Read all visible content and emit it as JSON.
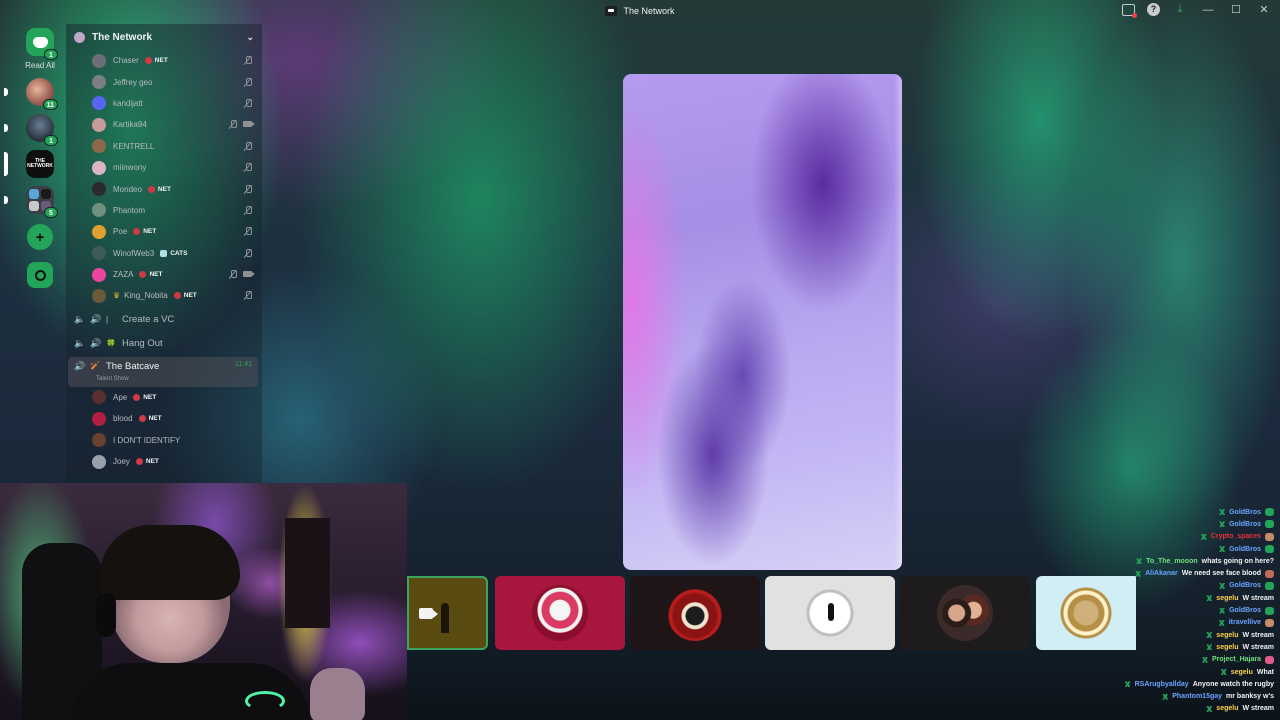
{
  "window": {
    "title": "The Network"
  },
  "rail": {
    "dm_badge": "1",
    "read_all": "Read All",
    "servers": [
      {
        "name": "server-1",
        "badge": "11"
      },
      {
        "name": "server-2",
        "badge": "1"
      },
      {
        "name": "the-network",
        "label": "THE NETWORK"
      },
      {
        "name": "folder",
        "badge": "5"
      }
    ],
    "add_label": "+"
  },
  "server": {
    "name": "The Network"
  },
  "voice_users_top": [
    {
      "name": "Chaser",
      "tag": "NET",
      "avatar": "#6d6f78",
      "icons": [
        "mic-off"
      ]
    },
    {
      "name": "Jeffrey geo",
      "tag": "",
      "avatar": "#7a7f86",
      "icons": [
        "mic-off"
      ]
    },
    {
      "name": "kandijatt",
      "tag": "",
      "avatar": "#5865f2",
      "icons": [
        "mic-off"
      ]
    },
    {
      "name": "Kartika94",
      "tag": "",
      "avatar": "#c89a9a",
      "icons": [
        "mic-off",
        "camera"
      ]
    },
    {
      "name": "KENTRELL",
      "tag": "",
      "avatar": "#8a6a4a",
      "icons": [
        "mic-off"
      ]
    },
    {
      "name": "miinwony",
      "tag": "",
      "avatar": "#d8b4c4",
      "icons": [
        "mic-off"
      ]
    },
    {
      "name": "Mondeo",
      "tag": "NET",
      "avatar": "#2a2a2f",
      "icons": [
        "mic-off"
      ]
    },
    {
      "name": "Phantom",
      "tag": "",
      "avatar": "#6f8f7f",
      "icons": [
        "mic-off"
      ]
    },
    {
      "name": "Poe",
      "tag": "NET",
      "avatar": "#e0a030",
      "icons": [
        "mic-off"
      ]
    },
    {
      "name": "WinofWeb3",
      "tag": "CATS",
      "avatar": "#3f5a5a",
      "icons": [
        "mic-off"
      ]
    },
    {
      "name": "ZAZA",
      "tag": "NET",
      "avatar": "#eb459e",
      "icons": [
        "mic-off",
        "camera"
      ]
    },
    {
      "name": "King_Nobita",
      "tag": "NET",
      "avatar": "#6a5a3a",
      "icons": [
        "mic-off"
      ]
    }
  ],
  "voice_channels": [
    {
      "name": "Create a VC",
      "emoji": "|"
    },
    {
      "name": "Hang Out",
      "emoji": "🍀"
    }
  ],
  "active_channel": {
    "name": "The Batcave",
    "time": "11:41",
    "status": "Talent Show"
  },
  "voice_users_bottom": [
    {
      "name": "Ape",
      "tag": "NET",
      "avatar": "#5a3030"
    },
    {
      "name": "blood",
      "tag": "NET",
      "avatar": "#b02040"
    },
    {
      "name": "I DON'T IDENTIFY",
      "tag": "",
      "avatar": "#6a4030"
    },
    {
      "name": "Joey",
      "tag": "NET",
      "avatar": "#9aa0aa"
    }
  ],
  "chat": [
    {
      "user": "GoldBros",
      "color": "#6aa4ff",
      "msg": "",
      "emote": "#23a559"
    },
    {
      "user": "GoldBros",
      "color": "#6aa4ff",
      "msg": "",
      "emote": "#23a559"
    },
    {
      "user": "Crypto_spaces",
      "color": "#e8333a",
      "msg": "",
      "emote": "#c78a6a"
    },
    {
      "user": "GoldBros",
      "color": "#6aa4ff",
      "msg": "",
      "emote": "#23a559"
    },
    {
      "user": "To_The_mooon",
      "color": "#6fe07c",
      "msg": "whats going on here?",
      "emote": ""
    },
    {
      "user": "AliAkanar",
      "color": "#6aa4ff",
      "msg": "We need see face blood",
      "emote": "#c26a5a"
    },
    {
      "user": "GoldBros",
      "color": "#6aa4ff",
      "msg": "",
      "emote": "#23a559"
    },
    {
      "user": "segelu",
      "color": "#ffd34a",
      "msg": "W stream",
      "emote": ""
    },
    {
      "user": "GoldBros",
      "color": "#6aa4ff",
      "msg": "",
      "emote": "#23a559"
    },
    {
      "user": "itravellive",
      "color": "#6aa4ff",
      "msg": "",
      "emote": "#c78a6a"
    },
    {
      "user": "segelu",
      "color": "#ffd34a",
      "msg": "W stream",
      "emote": ""
    },
    {
      "user": "segelu",
      "color": "#ffd34a",
      "msg": "W stream",
      "emote": ""
    },
    {
      "user": "Project_Hajara",
      "color": "#6fe07c",
      "msg": "",
      "emote": "#e05a8a"
    },
    {
      "user": "segelu",
      "color": "#ffd34a",
      "msg": "What",
      "emote": ""
    },
    {
      "user": "RSArugbyallday",
      "color": "#6aa4ff",
      "msg": "Anyone watch the rugby",
      "emote": ""
    },
    {
      "user": "Phantom15gay",
      "color": "#6aa4ff",
      "msg": "mr banksy w's",
      "emote": ""
    },
    {
      "user": "segelu",
      "color": "#ffd34a",
      "msg": "W stream",
      "emote": ""
    }
  ],
  "colors": {
    "accent": "#23a559",
    "net_tag": "#d23a43"
  }
}
